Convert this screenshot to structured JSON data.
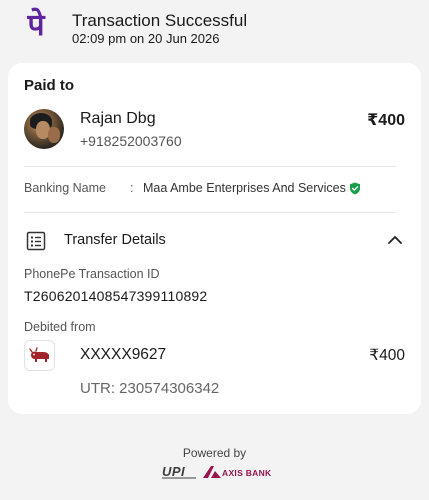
{
  "header": {
    "logo_glyph": "पे",
    "title": "Transaction Successful",
    "timestamp": "02:09 pm on 20 Jun 2026"
  },
  "paid_to": {
    "label": "Paid to",
    "name": "Rajan Dbg",
    "phone": "+918252003760",
    "amount": "₹400"
  },
  "banking": {
    "label": "Banking Name",
    "colon": ":",
    "value": "Maa Ambe Enterprises And Services",
    "verified_icon": "verified-shield-icon"
  },
  "transfer_details": {
    "title": "Transfer Details",
    "icon": "list-icon",
    "chevron_icon": "chevron-up-icon",
    "transaction_id_label": "PhonePe Transaction ID",
    "transaction_id": "T2606201408547399110892",
    "debited_label": "Debited from",
    "account": "XXXXX9627",
    "amount": "₹400",
    "utr": "UTR: 230574306342"
  },
  "footer": {
    "powered_by": "Powered by",
    "upi_logo_text": "UPI",
    "bank_logo_text": "AXIS BANK"
  },
  "colors": {
    "brand_purple": "#5f259f",
    "verified_green": "#1a9e4b",
    "axis_maroon": "#97144d",
    "background": "#f3f3f3"
  }
}
